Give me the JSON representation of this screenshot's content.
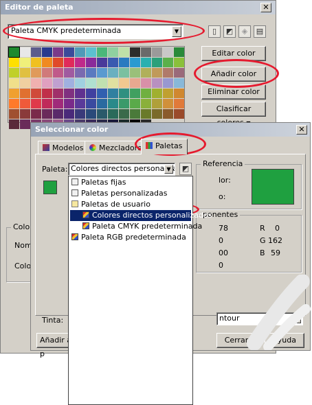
{
  "palette_editor": {
    "title": "Editor de paleta",
    "palette_select": "Paleta CMYK predeterminada",
    "toolbar": [
      "new-palette-icon",
      "open-palette-icon",
      "save-palette-icon",
      "save-as-icon"
    ],
    "buttons": {
      "edit": "Editar color",
      "add": "Añadir color",
      "remove": "Eliminar color",
      "sort": "Clasificar colores"
    },
    "side_labels": {
      "group": "Color",
      "name": "Nomb",
      "color": "Color"
    },
    "swatches": [
      "#1f8a2e",
      "#e8e8e8",
      "#5c5c8c",
      "#2a3a8e",
      "#7a3a8a",
      "#3a4a9a",
      "#4f9ab8",
      "#5cc0d0",
      "#4ab87a",
      "#8fd0a0",
      "#c0e0a8",
      "#2c2c2c",
      "#6a6a6a",
      "#9a9a9a",
      "#c8c8c8",
      "#2a8a3a",
      "#ffe000",
      "#f0f07a",
      "#f0c020",
      "#f08a20",
      "#e04a2a",
      "#e02a5a",
      "#c02a8a",
      "#8a2a9a",
      "#4a3a9a",
      "#3a5ab0",
      "#2a7ac0",
      "#2a9ad0",
      "#2ab0b0",
      "#2aa07a",
      "#5ab04a",
      "#8ac03a",
      "#c0d02a",
      "#e0c040",
      "#e09a5a",
      "#d07a7a",
      "#c05a8a",
      "#a05aa0",
      "#7a6ab0",
      "#5a7ac0",
      "#5a9ad0",
      "#6ab0c0",
      "#7ac0a0",
      "#9ac07a",
      "#b0b05a",
      "#c09a5a",
      "#b07a6a",
      "#9a6a7a",
      "#f0e08a",
      "#f0d0a0",
      "#f0b0b0",
      "#e0a0c0",
      "#c0a0d0",
      "#a0b0e0",
      "#a0d0e0",
      "#b0e0d0",
      "#c0e0b0",
      "#e0e0a0",
      "#f0c890",
      "#e8a890",
      "#d890a8",
      "#b890c0",
      "#9898d0",
      "#88b8d8",
      "#f0a030",
      "#e07030",
      "#d04a3a",
      "#c0304a",
      "#a0306a",
      "#803080",
      "#603090",
      "#4040a0",
      "#3060b0",
      "#3080a0",
      "#309080",
      "#40a060",
      "#70b040",
      "#a0b030",
      "#c0a030",
      "#d08830",
      "#ff7a2a",
      "#f05a3a",
      "#e03a4a",
      "#c02a5a",
      "#a02a7a",
      "#7a2a8a",
      "#5a3a9a",
      "#3a4aa0",
      "#2a6aa0",
      "#2a8a8a",
      "#3a9a6a",
      "#5aaa4a",
      "#8ab03a",
      "#b0a03a",
      "#d0903a",
      "#e07a3a",
      "#a05030",
      "#8a3a3a",
      "#7a2a4a",
      "#6a2a5a",
      "#5a2a6a",
      "#4a2a7a",
      "#3a3a7a",
      "#2a4a7a",
      "#2a5a6a",
      "#2a6a5a",
      "#3a6a4a",
      "#4a7a3a",
      "#6a7a2a",
      "#7a6a2a",
      "#8a5a2a",
      "#9a4a2a",
      "#5a2a3a",
      "#6a2a5a",
      "#7a3a6a",
      "#8a4a7a",
      "#9a5a8a",
      "#6a4a8a",
      "#4a3a6a",
      "#3a2a5a",
      "#2a2a4a",
      "#1a1a3a",
      "#1a2a2a",
      "#000000",
      "#2a2a2a",
      "#d4d0c8",
      "#d4d0c8",
      "#d4d0c8"
    ]
  },
  "select_color": {
    "title": "Seleccionar color",
    "tabs": [
      "Modelos",
      "Mezcladores",
      "Paletas"
    ],
    "palette_label": "Paleta:",
    "palette_value": "Colores directos personalizado",
    "reference_title": "Referencia",
    "reference_labels": [
      "lor:",
      "o:"
    ],
    "reference_color": "#1fa040",
    "preview_color": "#1fa040",
    "components_title": "ponentes",
    "components": {
      "left": [
        "78",
        "0",
        "00",
        "0"
      ],
      "right_labels": [
        "R",
        "G",
        "B"
      ],
      "right_values": [
        "0",
        "162",
        "59"
      ]
    },
    "dropdown_items": [
      {
        "label": "Paletas fijas",
        "icon": "folder-icon",
        "indent": 0
      },
      {
        "label": "Paletas personalizadas",
        "icon": "folder-icon",
        "indent": 0
      },
      {
        "label": "Paletas de usuario",
        "icon": "open-folder-icon",
        "indent": 0
      },
      {
        "label": "Colores directos personalizados",
        "icon": "palette-icon",
        "indent": 1,
        "selected": true
      },
      {
        "label": "Paleta CMYK predeterminada",
        "icon": "palette-icon",
        "indent": 1
      },
      {
        "label": "Paleta RGB predeterminada",
        "icon": "palette-icon",
        "indent": 0
      }
    ],
    "tint_label": "Tinta:",
    "tint_value": "ntour",
    "buttons": {
      "add": "Añadir a p",
      "close": "Cerrar",
      "help": "Ayuda"
    }
  },
  "colors": {
    "highlight": "#ec1c24",
    "selection": "#0a246a"
  }
}
